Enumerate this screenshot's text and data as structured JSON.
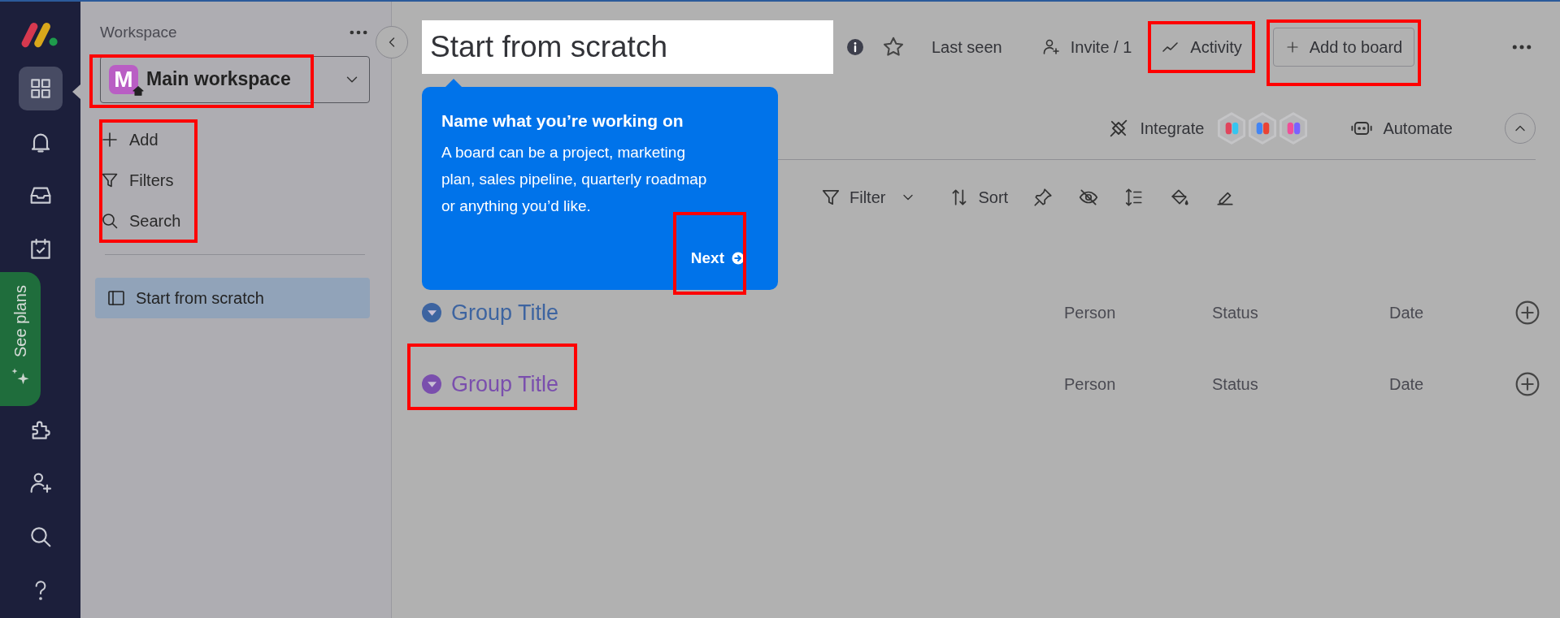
{
  "nav_rail": {
    "items": [
      {
        "kind": "boards",
        "selected": true
      },
      {
        "kind": "notifications",
        "selected": false
      },
      {
        "kind": "inbox",
        "selected": false
      },
      {
        "kind": "my_work",
        "selected": false
      }
    ],
    "upgrade_tab": {
      "label": "See plans"
    },
    "bottom_items": [
      {
        "kind": "apps"
      },
      {
        "kind": "invite"
      },
      {
        "kind": "search"
      },
      {
        "kind": "help"
      }
    ]
  },
  "sidebar": {
    "heading": "Workspace",
    "workspace": {
      "initial": "M",
      "name": "Main workspace",
      "highlighted": true
    },
    "actions": [
      {
        "kind": "add",
        "label": "Add"
      },
      {
        "kind": "filter",
        "label": "Filters"
      },
      {
        "kind": "search",
        "label": "Search"
      }
    ],
    "actions_highlighted": true,
    "boards": [
      {
        "name": "Start from scratch",
        "selected": true
      }
    ]
  },
  "board": {
    "title": "Start from scratch",
    "header_actions": [
      {
        "kind": "last_seen",
        "label": "Last seen",
        "highlighted": false
      },
      {
        "kind": "invite",
        "label": "Invite / 1",
        "highlighted": false
      },
      {
        "kind": "activity",
        "label": "Activity",
        "highlighted": true
      },
      {
        "kind": "add",
        "label": "Add to board",
        "highlighted": true
      }
    ],
    "integrate_label": "Integrate",
    "automate_label": "Automate",
    "toolbar": [
      {
        "kind": "filter",
        "label": "Filter"
      },
      {
        "kind": "sort",
        "label": "Sort"
      },
      {
        "kind": "pin"
      },
      {
        "kind": "hide"
      },
      {
        "kind": "row_height"
      },
      {
        "kind": "color"
      },
      {
        "kind": "format"
      }
    ],
    "groups": [
      {
        "title": "Group Title",
        "color": "#3d64a0",
        "highlighted": false,
        "columns": [
          "Person",
          "Status",
          "Date"
        ]
      },
      {
        "title": "Group Title",
        "color": "#7a4fad",
        "highlighted": true,
        "columns": [
          "Person",
          "Status",
          "Date"
        ]
      }
    ]
  },
  "tooltip": {
    "title": "Name what you’re working on",
    "body": "A board can be a project, marketing plan, sales pipeline, quarterly roadmap or anything you’d like.",
    "button": "Next",
    "button_highlighted": true
  }
}
